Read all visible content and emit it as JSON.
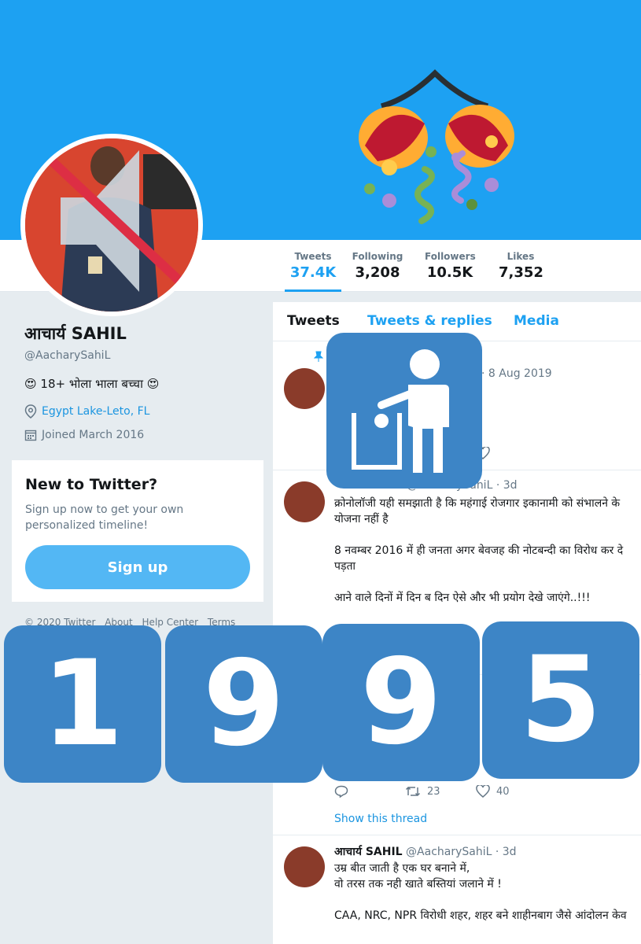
{
  "profile": {
    "name": "आचार्य SAHIL",
    "handle": "@AacharySahiL",
    "bio": "😍 18+ भोला भाला बच्चा 😍",
    "location": "Egypt Lake-Leto, FL",
    "joined": "Joined March 2016"
  },
  "stats": [
    {
      "label": "Tweets",
      "value": "37.4K"
    },
    {
      "label": "Following",
      "value": "3,208"
    },
    {
      "label": "Followers",
      "value": "10.5K"
    },
    {
      "label": "Likes",
      "value": "7,352"
    }
  ],
  "new_box": {
    "title": "New to Twitter?",
    "text": "Sign up now to get your own personalized timeline!",
    "button": "Sign up"
  },
  "footer": [
    "© 2020 Twitter",
    "About",
    "Help Center",
    "Terms"
  ],
  "tabs": [
    "Tweets",
    "Tweets & replies",
    "Media"
  ],
  "tweets": [
    {
      "meta": "hiL · 8 Aug 2019"
    },
    {
      "meta": "@AacharySahiL · 3d",
      "text": "क्रोनोलॉजी यही समझाती है कि महंगाई रोजगार इकानामी को संभालने के\nयोजना नहीं है\n\n8 नवम्बर 2016 में ही जनता अगर बेवजह की नोटबन्दी का विरोध कर दे\nपड़ता\n\nआने वाले दिनों में दिन ब दिन ऐसे और भी प्रयोग देखे जाएंगे..!!!"
    },
    {
      "retweets": "23",
      "likes": "40",
      "thread": "Show this thread"
    },
    {
      "name": "आचार्य SAHIL",
      "meta": "@AacharySahiL · 3d",
      "text": "उम्र बीत जाती है एक घर बनाने में,\nवो तरस तक नही खाते बस्तियां जलाने में !\n\nCAA, NRC, NPR विरोधी शहर, शहर बने शाहीनबाग जैसे आंदोलन केव"
    }
  ],
  "overlay_digits": [
    "1",
    "9",
    "9",
    "5"
  ],
  "colors": {
    "brand": "#1da1f2",
    "tile": "#3d85c6",
    "banner": "#1da1f2"
  }
}
